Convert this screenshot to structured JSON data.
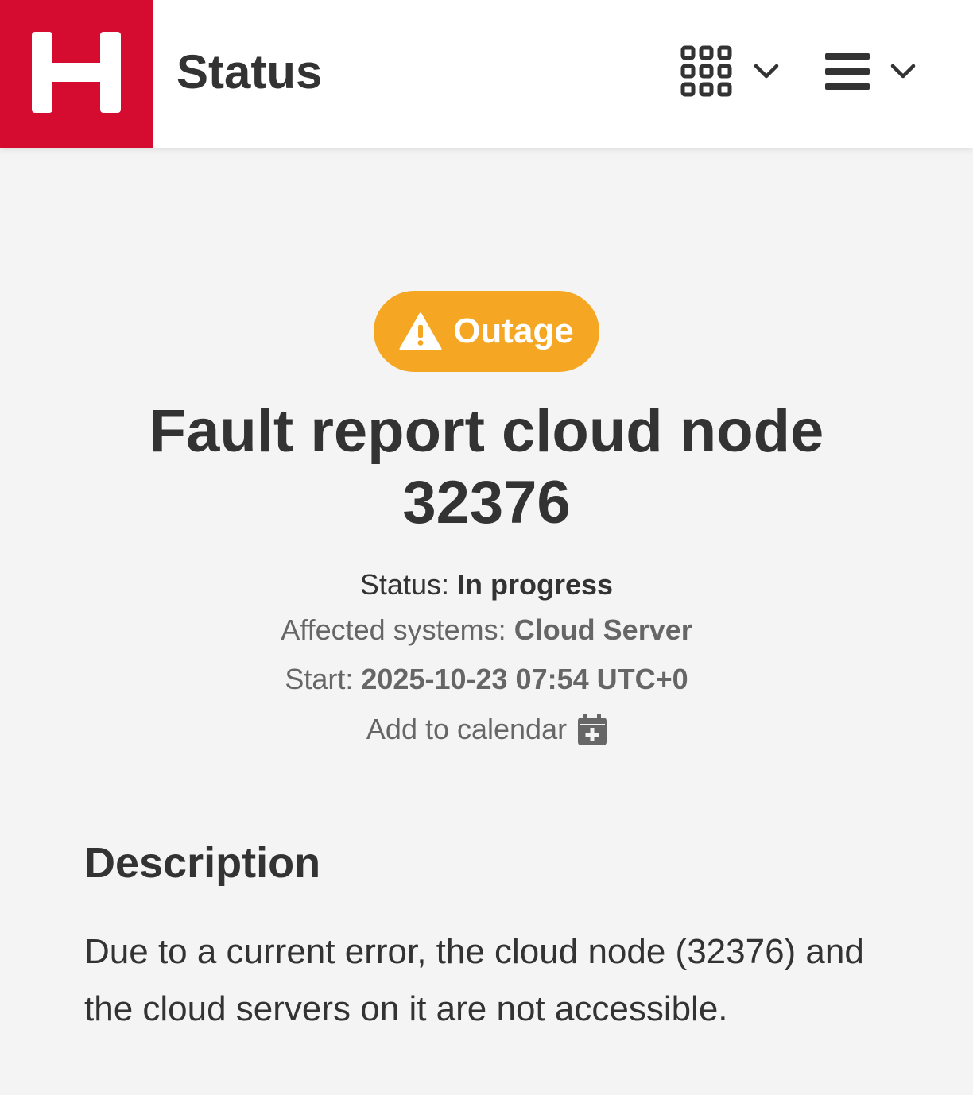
{
  "header": {
    "logo_letter": "H",
    "brand_color": "#d50c2f",
    "title": "Status",
    "apps_icon": "grid-icon",
    "menu_icon": "hamburger-icon"
  },
  "incident": {
    "badge": {
      "label": "Outage",
      "icon": "warning-icon",
      "color": "#f5a623"
    },
    "title": "Fault report cloud node 32376",
    "status_label": "Status:",
    "status_value": "In progress",
    "affected_label": "Affected systems:",
    "affected_value": "Cloud Server",
    "start_label": "Start:",
    "start_value": "2025-10-23 07:54 UTC+0",
    "add_to_calendar": "Add to calendar",
    "calendar_icon": "calendar-plus-icon"
  },
  "description": {
    "heading": "Description",
    "text": "Due to a current error, the cloud node (32376) and the cloud servers on it are not accessible."
  }
}
